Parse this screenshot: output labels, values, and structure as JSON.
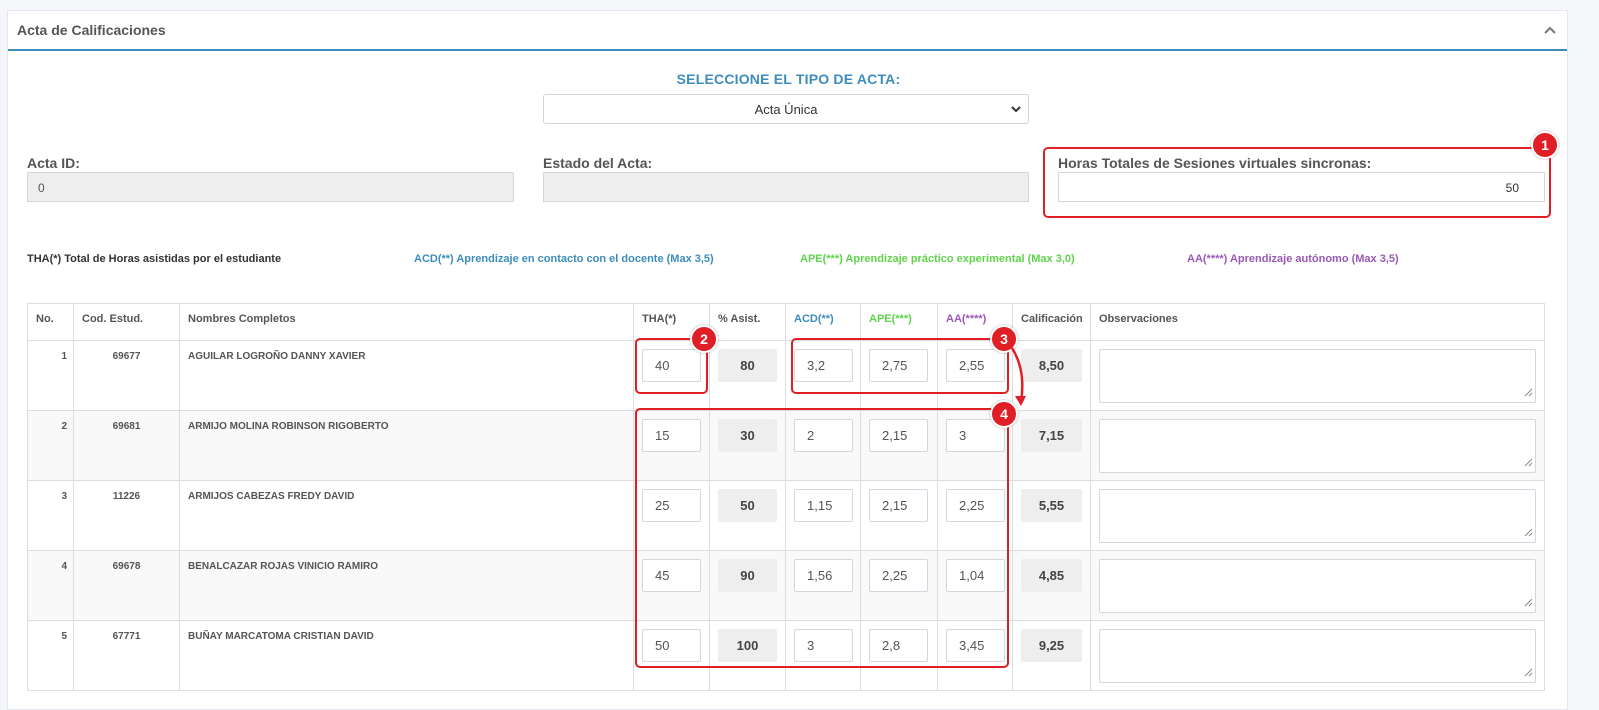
{
  "panel": {
    "title": "Acta de Calificaciones",
    "collapse_icon": "chevron-up-icon"
  },
  "acta_type": {
    "label": "SELECCIONE EL TIPO DE ACTA:",
    "selected": "Acta Única"
  },
  "fields": {
    "acta_id_label": "Acta ID:",
    "acta_id_value": "0",
    "estado_label": "Estado del Acta:",
    "estado_value": "",
    "horas_label": "Horas Totales de Sesiones virtuales sincronas:",
    "horas_value": "50"
  },
  "legend": {
    "tha": "THA(*) Total de Horas asistidas por el estudiante",
    "acd": "ACD(**) Aprendizaje en contacto con el docente (Max 3,5)",
    "ape": "APE(***) Aprendizaje práctico experimental (Max 3,0)",
    "aa": "AA(****) Aprendizaje autónomo (Max 3,5)"
  },
  "colors": {
    "acd": "#3c8dbc",
    "ape": "#5fd34b",
    "aa": "#9b59b6",
    "annotation": "#e01e25"
  },
  "table": {
    "headers": [
      "No.",
      "Cod. Estud.",
      "Nombres Completos",
      "THA(*)",
      "% Asist.",
      "ACD(**)",
      "APE(***)",
      "AA(****)",
      "Calificación",
      "Observaciones"
    ],
    "rows": [
      {
        "no": "1",
        "cod": "69677",
        "name": "AGUILAR LOGROÑO DANNY XAVIER",
        "tha": "40",
        "asist": "80",
        "acd": "3,2",
        "ape": "2,75",
        "aa": "2,55",
        "grade": "8,50",
        "obs": ""
      },
      {
        "no": "2",
        "cod": "69681",
        "name": "ARMIJO MOLINA ROBINSON RIGOBERTO",
        "tha": "15",
        "asist": "30",
        "acd": "2",
        "ape": "2,15",
        "aa": "3",
        "grade": "7,15",
        "obs": ""
      },
      {
        "no": "3",
        "cod": "11226",
        "name": "ARMIJOS CABEZAS FREDY DAVID",
        "tha": "25",
        "asist": "50",
        "acd": "1,15",
        "ape": "2,15",
        "aa": "2,25",
        "grade": "5,55",
        "obs": ""
      },
      {
        "no": "4",
        "cod": "69678",
        "name": "BENALCAZAR ROJAS VINICIO RAMIRO",
        "tha": "45",
        "asist": "90",
        "acd": "1,56",
        "ape": "2,25",
        "aa": "1,04",
        "grade": "4,85",
        "obs": ""
      },
      {
        "no": "5",
        "cod": "67771",
        "name": "BUÑAY MARCATOMA CRISTIAN DAVID",
        "tha": "50",
        "asist": "100",
        "acd": "3",
        "ape": "2,8",
        "aa": "3,45",
        "grade": "9,25",
        "obs": ""
      }
    ]
  },
  "annotations": {
    "b1": "1",
    "b2": "2",
    "b3": "3",
    "b4": "4"
  }
}
